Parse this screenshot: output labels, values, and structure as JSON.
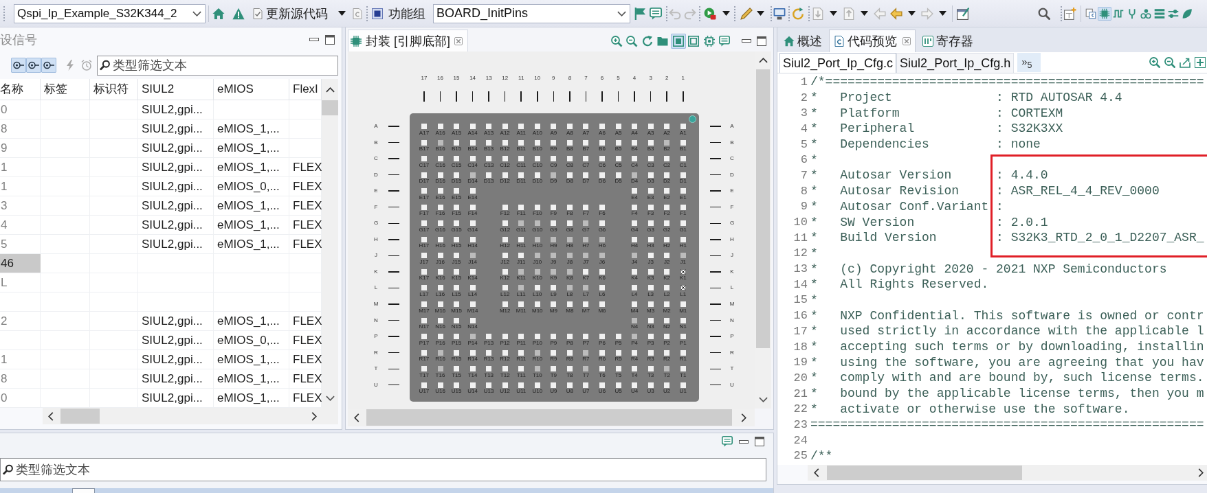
{
  "toolbar": {
    "project": "Qspi_Ip_Example_S32K344_2",
    "update_button": "更新源代码",
    "function_group_label": "功能组",
    "function_group": "BOARD_InitPins",
    "perspectives": [
      {
        "selected": false
      },
      {
        "selected": true
      },
      {
        "selected": false
      },
      {
        "selected": false
      },
      {
        "selected": false
      },
      {
        "selected": false
      },
      {
        "selected": false
      },
      {
        "selected": false
      }
    ]
  },
  "signals_panel": {
    "title": "设信号",
    "filter_toggles": [
      {
        "selected": true
      },
      {
        "selected": true
      },
      {
        "selected": true
      }
    ],
    "search": {
      "placeholder": "类型筛选文本"
    },
    "columns": [
      "名称",
      "标签",
      "标识符",
      "SIUL2",
      "eMIOS",
      "FlexI"
    ],
    "rows": [
      {
        "name": "0",
        "siul2": "SIUL2,gpi...",
        "selected": false
      },
      {
        "name": "8",
        "siul2": "SIUL2,gpi...",
        "emios": "eMIOS_1,...",
        "selected": false
      },
      {
        "name": "9",
        "siul2": "SIUL2,gpi...",
        "emios": "eMIOS_1,...",
        "selected": false
      },
      {
        "name": "1",
        "siul2": "SIUL2,gpi...",
        "emios": "eMIOS_1,...",
        "flexi": "FLEX",
        "selected": false
      },
      {
        "name": "1",
        "siul2": "SIUL2,gpi...",
        "emios": "eMIOS_0,...",
        "flexi": "FLEX",
        "selected": false
      },
      {
        "name": "3",
        "siul2": "SIUL2,gpi...",
        "emios": "eMIOS_1,...",
        "flexi": "FLEX",
        "selected": false
      },
      {
        "name": "4",
        "siul2": "SIUL2,gpi...",
        "emios": "eMIOS_1,...",
        "flexi": "FLEX",
        "selected": false
      },
      {
        "name": "5",
        "siul2": "SIUL2,gpi...",
        "emios": "eMIOS_1,...",
        "flexi": "FLEX",
        "selected": false
      },
      {
        "name": "46",
        "selected": true
      },
      {
        "name": "L",
        "selected": false
      },
      {
        "selected": false
      },
      {
        "name": "2",
        "siul2": "SIUL2,gpi...",
        "emios": "eMIOS_1,...",
        "flexi": "FLEX",
        "selected": false
      },
      {
        "siul2": "SIUL2,gpi...",
        "emios": "eMIOS_0,...",
        "flexi": "FLEX",
        "selected": false
      },
      {
        "name": "1",
        "siul2": "SIUL2,gpi...",
        "emios": "eMIOS_1,...",
        "flexi": "FLEX",
        "selected": false
      },
      {
        "name": "8",
        "siul2": "SIUL2,gpi...",
        "emios": "eMIOS_1,...",
        "flexi": "FLEX",
        "selected": false
      },
      {
        "name": "0",
        "siul2": "SIUL2,gpi...",
        "emios": "eMIOS_1,...",
        "flexi": "FLEX",
        "selected": false
      }
    ]
  },
  "package_panel": {
    "tab": "封装 [引脚底部]",
    "tools": [
      {
        "selected": false
      },
      {
        "selected": false
      },
      {
        "selected": false
      },
      {
        "selected": false
      },
      {
        "selected": true
      },
      {
        "selected": false
      },
      {
        "selected": false
      },
      {
        "selected": false
      }
    ],
    "column_numbers": [
      "17",
      "16",
      "15",
      "14",
      "13",
      "12",
      "11",
      "10",
      "9",
      "8",
      "7",
      "6",
      "5",
      "4",
      "3",
      "2",
      "1"
    ],
    "rows": [
      {
        "letter_left": "A",
        "letter_right": "A",
        "pins_left": [
          {
            "label": "A17",
            "kind": "plain"
          },
          {
            "label": "A16",
            "kind": "plain"
          },
          {
            "label": "A15",
            "kind": "plain"
          },
          {
            "label": "A14",
            "kind": "plain"
          }
        ],
        "pins_center": [
          {
            "label": "A13",
            "kind": "plain"
          },
          {
            "label": "A12",
            "kind": "plain"
          },
          {
            "label": "A11",
            "kind": "plain"
          },
          {
            "label": "A10",
            "kind": "plain"
          },
          {
            "label": "A9",
            "kind": "plain"
          },
          {
            "label": "A8",
            "kind": "plain"
          },
          {
            "label": "A7",
            "kind": "plain"
          },
          {
            "label": "A6",
            "kind": "plain"
          },
          {
            "label": "A5",
            "kind": "plain"
          }
        ],
        "pins_right": [
          {
            "label": "A4",
            "kind": "plain"
          },
          {
            "label": "A3",
            "kind": "plain"
          },
          {
            "label": "A2",
            "kind": "plain"
          },
          {
            "label": "A1",
            "kind": "plain"
          }
        ]
      },
      {
        "letter_left": "B",
        "letter_right": "B",
        "pins_left": [
          {
            "label": "B17",
            "kind": "plain"
          },
          {
            "label": "B16",
            "kind": "shaded"
          },
          {
            "label": "B15",
            "kind": "plain"
          },
          {
            "label": "B14",
            "kind": "plain"
          }
        ],
        "pins_center": [
          {
            "label": "B13",
            "kind": "plain"
          },
          {
            "label": "B12",
            "kind": "plain"
          },
          {
            "label": "B11",
            "kind": "plain"
          },
          {
            "label": "B10",
            "kind": "plain"
          },
          {
            "label": "B9",
            "kind": "plain"
          },
          {
            "label": "B8",
            "kind": "plain"
          },
          {
            "label": "B7",
            "kind": "plain"
          },
          {
            "label": "B6",
            "kind": "plain"
          },
          {
            "label": "B5",
            "kind": "plain"
          }
        ],
        "pins_right": [
          {
            "label": "B4",
            "kind": "plain"
          },
          {
            "label": "B3",
            "kind": "plain"
          },
          {
            "label": "B2",
            "kind": "shaded"
          },
          {
            "label": "B1",
            "kind": "plain"
          }
        ]
      },
      {
        "letter_left": "C",
        "letter_right": "C",
        "pins_left": [
          {
            "label": "C17",
            "kind": "plain"
          },
          {
            "label": "C16",
            "kind": "plain"
          },
          {
            "label": "C15",
            "kind": "plain"
          },
          {
            "label": "C14",
            "kind": "plain"
          }
        ],
        "pins_center": [
          {
            "label": "C13",
            "kind": "plain"
          },
          {
            "label": "C12",
            "kind": "plain"
          },
          {
            "label": "C11",
            "kind": "plain"
          },
          {
            "label": "C10",
            "kind": "plain"
          },
          {
            "label": "C9",
            "kind": "plain"
          },
          {
            "label": "C8",
            "kind": "plain"
          },
          {
            "label": "C7",
            "kind": "plain"
          },
          {
            "label": "C6",
            "kind": "plain"
          },
          {
            "label": "C5",
            "kind": "plain"
          }
        ],
        "pins_right": [
          {
            "label": "C4",
            "kind": "plain"
          },
          {
            "label": "C3",
            "kind": "plain"
          },
          {
            "label": "C2",
            "kind": "plain"
          },
          {
            "label": "C1",
            "kind": "plain"
          }
        ]
      },
      {
        "letter_left": "D",
        "letter_right": "D",
        "pins_left": [
          {
            "label": "D17",
            "kind": "plain"
          },
          {
            "label": "D16",
            "kind": "plain"
          },
          {
            "label": "D15",
            "kind": "plain"
          },
          {
            "label": "D14",
            "kind": "shaded"
          }
        ],
        "pins_center": [
          {
            "label": "D13",
            "kind": "plain"
          },
          {
            "label": "D12",
            "kind": "plain"
          },
          {
            "label": "D11",
            "kind": "plain"
          },
          {
            "label": "D10",
            "kind": "plain"
          },
          {
            "label": "D9",
            "kind": "shaded"
          },
          {
            "label": "D8",
            "kind": "plain"
          },
          {
            "label": "D7",
            "kind": "plain"
          },
          {
            "label": "D6",
            "kind": "plain"
          },
          {
            "label": "D5",
            "kind": "plain"
          }
        ],
        "pins_right": [
          {
            "label": "D4",
            "kind": "shaded"
          },
          {
            "label": "D3",
            "kind": "plain"
          },
          {
            "label": "D2",
            "kind": "plain"
          },
          {
            "label": "D1",
            "kind": "plain"
          }
        ]
      },
      {
        "letter_left": "E",
        "letter_right": "E",
        "pins_left": [
          {
            "label": "E17",
            "kind": "plain"
          },
          {
            "label": "E16",
            "kind": "plain"
          },
          {
            "label": "E15",
            "kind": "plain"
          },
          {
            "label": "E14",
            "kind": "plain"
          }
        ],
        "pins_right": [
          {
            "label": "E4",
            "kind": "plain"
          },
          {
            "label": "E3",
            "kind": "plain"
          },
          {
            "label": "E2",
            "kind": "plain"
          },
          {
            "label": "E1",
            "kind": "plain"
          }
        ]
      },
      {
        "letter_left": "F",
        "letter_right": "F",
        "pins_left": [
          {
            "label": "F17",
            "kind": "plain"
          },
          {
            "label": "F16",
            "kind": "plain"
          },
          {
            "label": "F15",
            "kind": "plain"
          },
          {
            "label": "F14",
            "kind": "plain"
          }
        ],
        "pins_center": [
          {
            "label": "F12",
            "kind": "plain"
          },
          {
            "label": "F11",
            "kind": "plain"
          },
          {
            "label": "F10",
            "kind": "plain"
          },
          {
            "label": "F9",
            "kind": "plain"
          },
          {
            "label": "F8",
            "kind": "plain"
          },
          {
            "label": "F7",
            "kind": "plain"
          },
          {
            "label": "F6",
            "kind": "plain"
          }
        ],
        "pins_right": [
          {
            "label": "F4",
            "kind": "plain"
          },
          {
            "label": "F3",
            "kind": "plain"
          },
          {
            "label": "F2",
            "kind": "plain"
          },
          {
            "label": "F1",
            "kind": "plain"
          }
        ]
      },
      {
        "letter_left": "G",
        "letter_right": "G",
        "pins_left": [
          {
            "label": "G17",
            "kind": "plain"
          },
          {
            "label": "G16",
            "kind": "plain"
          },
          {
            "label": "G15",
            "kind": "plain"
          },
          {
            "label": "G14",
            "kind": "plain"
          }
        ],
        "pins_center": [
          {
            "label": "G12",
            "kind": "plain"
          },
          {
            "label": "G11",
            "kind": "shaded"
          },
          {
            "label": "G10",
            "kind": "shaded"
          },
          {
            "label": "G9",
            "kind": "plain"
          },
          {
            "label": "G8",
            "kind": "plain"
          },
          {
            "label": "G7",
            "kind": "shaded"
          },
          {
            "label": "G6",
            "kind": "plain"
          }
        ],
        "pins_right": [
          {
            "label": "G4",
            "kind": "plain"
          },
          {
            "label": "G3",
            "kind": "plain"
          },
          {
            "label": "G2",
            "kind": "plain"
          },
          {
            "label": "G1",
            "kind": "plain"
          }
        ]
      },
      {
        "letter_left": "H",
        "letter_right": "H",
        "pins_left": [
          {
            "label": "H17",
            "kind": "plain"
          },
          {
            "label": "H16",
            "kind": "plain"
          },
          {
            "label": "H15",
            "kind": "plain"
          },
          {
            "label": "H14",
            "kind": "plain"
          }
        ],
        "pins_center": [
          {
            "label": "H12",
            "kind": "plain"
          },
          {
            "label": "H11",
            "kind": "plain"
          },
          {
            "label": "H10",
            "kind": "shaded"
          },
          {
            "label": "H9",
            "kind": "shaded"
          },
          {
            "label": "H8",
            "kind": "shaded"
          },
          {
            "label": "H7",
            "kind": "shaded"
          },
          {
            "label": "H6",
            "kind": "shaded"
          }
        ],
        "pins_right": [
          {
            "label": "H4",
            "kind": "plain"
          },
          {
            "label": "H3",
            "kind": "plain"
          },
          {
            "label": "H2",
            "kind": "plain"
          },
          {
            "label": "H1",
            "kind": "plain"
          }
        ]
      },
      {
        "letter_left": "J",
        "letter_right": "J",
        "pins_left": [
          {
            "label": "J17",
            "kind": "plain"
          },
          {
            "label": "J16",
            "kind": "plain"
          },
          {
            "label": "J15",
            "kind": "plain"
          },
          {
            "label": "J14",
            "kind": "shaded"
          }
        ],
        "pins_center": [
          {
            "label": "J12",
            "kind": "plain"
          },
          {
            "label": "J11",
            "kind": "plain"
          },
          {
            "label": "J10",
            "kind": "shaded"
          },
          {
            "label": "J9",
            "kind": "shaded"
          },
          {
            "label": "J8",
            "kind": "shaded"
          },
          {
            "label": "J7",
            "kind": "shaded"
          },
          {
            "label": "J6",
            "kind": "shaded"
          }
        ],
        "pins_right": [
          {
            "label": "J4",
            "kind": "shaded"
          },
          {
            "label": "J3",
            "kind": "plain"
          },
          {
            "label": "J2",
            "kind": "plain"
          },
          {
            "label": "J1",
            "kind": "shaded"
          }
        ]
      },
      {
        "letter_left": "K",
        "letter_right": "K",
        "pins_left": [
          {
            "label": "K17",
            "kind": "plain"
          },
          {
            "label": "K16",
            "kind": "plain"
          },
          {
            "label": "K15",
            "kind": "plain"
          },
          {
            "label": "K14",
            "kind": "plain"
          }
        ],
        "pins_center": [
          {
            "label": "K12",
            "kind": "plain"
          },
          {
            "label": "K11",
            "kind": "shaded"
          },
          {
            "label": "K10",
            "kind": "shaded"
          },
          {
            "label": "K9",
            "kind": "shaded"
          },
          {
            "label": "K8",
            "kind": "shaded"
          },
          {
            "label": "K7",
            "kind": "plain"
          },
          {
            "label": "K6",
            "kind": "plain"
          }
        ],
        "pins_right": [
          {
            "label": "K4",
            "kind": "plain"
          },
          {
            "label": "K3",
            "kind": "plain"
          },
          {
            "label": "K2",
            "kind": "plain"
          },
          {
            "label": "K1",
            "kind": "crossed"
          }
        ]
      },
      {
        "letter_left": "L",
        "letter_right": "L",
        "pins_left": [
          {
            "label": "L17",
            "kind": "plain"
          },
          {
            "label": "L16",
            "kind": "plain"
          },
          {
            "label": "L15",
            "kind": "plain"
          },
          {
            "label": "L14",
            "kind": "plain"
          }
        ],
        "pins_center": [
          {
            "label": "L12",
            "kind": "plain"
          },
          {
            "label": "L11",
            "kind": "shaded"
          },
          {
            "label": "L10",
            "kind": "plain"
          },
          {
            "label": "L9",
            "kind": "plain"
          },
          {
            "label": "L8",
            "kind": "shaded"
          },
          {
            "label": "L7",
            "kind": "shaded"
          },
          {
            "label": "L6",
            "kind": "plain"
          }
        ],
        "pins_right": [
          {
            "label": "L4",
            "kind": "plain"
          },
          {
            "label": "L3",
            "kind": "plain"
          },
          {
            "label": "L2",
            "kind": "plain"
          },
          {
            "label": "L1",
            "kind": "crossed"
          }
        ]
      },
      {
        "letter_left": "M",
        "letter_right": "M",
        "pins_left": [
          {
            "label": "M17",
            "kind": "plain"
          },
          {
            "label": "M16",
            "kind": "plain"
          },
          {
            "label": "M15",
            "kind": "plain"
          },
          {
            "label": "M14",
            "kind": "plain"
          }
        ],
        "pins_center": [
          {
            "label": "M12",
            "kind": "plain"
          },
          {
            "label": "M11",
            "kind": "plain"
          },
          {
            "label": "M10",
            "kind": "plain"
          },
          {
            "label": "M9",
            "kind": "plain"
          },
          {
            "label": "M8",
            "kind": "plain"
          },
          {
            "label": "M7",
            "kind": "plain"
          },
          {
            "label": "M6",
            "kind": "plain"
          }
        ],
        "pins_right": [
          {
            "label": "M4",
            "kind": "plain"
          },
          {
            "label": "M3",
            "kind": "plain"
          },
          {
            "label": "M2",
            "kind": "plain"
          },
          {
            "label": "M1",
            "kind": "plain"
          }
        ]
      },
      {
        "letter_left": "N",
        "letter_right": "N",
        "pins_left": [
          {
            "label": "N17",
            "kind": "plain"
          },
          {
            "label": "N16",
            "kind": "plain"
          },
          {
            "label": "N15",
            "kind": "plain"
          },
          {
            "label": "N14",
            "kind": "plain"
          }
        ],
        "pins_right": [
          {
            "label": "N4",
            "kind": "shaded"
          },
          {
            "label": "N3",
            "kind": "plain"
          },
          {
            "label": "N2",
            "kind": "plain"
          },
          {
            "label": "N1",
            "kind": "plain"
          }
        ]
      },
      {
        "letter_left": "P",
        "letter_right": "P",
        "pins_left": [
          {
            "label": "P17",
            "kind": "plain"
          },
          {
            "label": "P16",
            "kind": "plain"
          },
          {
            "label": "P15",
            "kind": "plain"
          },
          {
            "label": "P14",
            "kind": "shaded"
          }
        ],
        "pins_center": [
          {
            "label": "P13",
            "kind": "plain"
          },
          {
            "label": "P12",
            "kind": "plain"
          },
          {
            "label": "P11",
            "kind": "plain"
          },
          {
            "label": "P10",
            "kind": "plain"
          },
          {
            "label": "P9",
            "kind": "plain"
          },
          {
            "label": "P8",
            "kind": "plain"
          },
          {
            "label": "P7",
            "kind": "plain"
          },
          {
            "label": "P6",
            "kind": "plain"
          },
          {
            "label": "P5",
            "kind": "plain"
          }
        ],
        "pins_right": [
          {
            "label": "P4",
            "kind": "shaded"
          },
          {
            "label": "P3",
            "kind": "plain"
          },
          {
            "label": "P2",
            "kind": "plain"
          },
          {
            "label": "P1",
            "kind": "plain"
          }
        ]
      },
      {
        "letter_left": "R",
        "letter_right": "R",
        "pins_left": [
          {
            "label": "R17",
            "kind": "plain"
          },
          {
            "label": "R16",
            "kind": "shaded"
          },
          {
            "label": "R15",
            "kind": "plain"
          },
          {
            "label": "R14",
            "kind": "plain"
          }
        ],
        "pins_center": [
          {
            "label": "R13",
            "kind": "plain"
          },
          {
            "label": "R12",
            "kind": "plain"
          },
          {
            "label": "R11",
            "kind": "plain"
          },
          {
            "label": "R10",
            "kind": "shaded"
          },
          {
            "label": "R9",
            "kind": "plain"
          },
          {
            "label": "R8",
            "kind": "plain"
          },
          {
            "label": "R7",
            "kind": "shaded"
          },
          {
            "label": "R6",
            "kind": "plain"
          },
          {
            "label": "R5",
            "kind": "plain"
          }
        ],
        "pins_right": [
          {
            "label": "R4",
            "kind": "plain"
          },
          {
            "label": "R3",
            "kind": "plain"
          },
          {
            "label": "R2",
            "kind": "plain"
          },
          {
            "label": "R1",
            "kind": "plain"
          }
        ]
      },
      {
        "letter_left": "T",
        "letter_right": "T",
        "pins_left": [
          {
            "label": "T17",
            "kind": "plain"
          },
          {
            "label": "T16",
            "kind": "shaded"
          },
          {
            "label": "T15",
            "kind": "plain"
          },
          {
            "label": "T14",
            "kind": "plain"
          }
        ],
        "pins_center": [
          {
            "label": "T13",
            "kind": "plain"
          },
          {
            "label": "T12",
            "kind": "plain"
          },
          {
            "label": "T11",
            "kind": "plain"
          },
          {
            "label": "T10",
            "kind": "shaded"
          },
          {
            "label": "T9",
            "kind": "plain"
          },
          {
            "label": "T8",
            "kind": "plain"
          },
          {
            "label": "T7",
            "kind": "shaded"
          },
          {
            "label": "T6",
            "kind": "plain"
          },
          {
            "label": "T5",
            "kind": "plain"
          }
        ],
        "pins_right": [
          {
            "label": "T4",
            "kind": "plain"
          },
          {
            "label": "T3",
            "kind": "plain"
          },
          {
            "label": "T2",
            "kind": "shaded"
          },
          {
            "label": "T1",
            "kind": "plain"
          }
        ]
      },
      {
        "letter_left": "U",
        "letter_right": "U",
        "pins_left": [
          {
            "label": "U17",
            "kind": "plain"
          },
          {
            "label": "U16",
            "kind": "plain"
          },
          {
            "label": "U15",
            "kind": "plain"
          },
          {
            "label": "U14",
            "kind": "plain"
          }
        ],
        "pins_center": [
          {
            "label": "U13",
            "kind": "plain"
          },
          {
            "label": "U12",
            "kind": "plain"
          },
          {
            "label": "U11",
            "kind": "plain"
          },
          {
            "label": "U10",
            "kind": "plain"
          },
          {
            "label": "U9",
            "kind": "plain"
          },
          {
            "label": "U8",
            "kind": "plain"
          },
          {
            "label": "U7",
            "kind": "plain"
          },
          {
            "label": "U6",
            "kind": "plain"
          },
          {
            "label": "U5",
            "kind": "plain"
          }
        ],
        "pins_right": [
          {
            "label": "U4",
            "kind": "plain"
          },
          {
            "label": "U3",
            "kind": "plain"
          },
          {
            "label": "U2",
            "kind": "plain"
          },
          {
            "label": "U1",
            "kind": "plain"
          }
        ]
      }
    ]
  },
  "code_panel": {
    "tabs": [
      {
        "label": "概述",
        "selected": false
      },
      {
        "label": "代码预览",
        "selected": true
      },
      {
        "label": "寄存器",
        "selected": false
      }
    ],
    "file_tabs": [
      {
        "label": "Siul2_Port_Ip_Cfg.c",
        "selected": true
      },
      {
        "label": "Siul2_Port_Ip_Cfg.h",
        "selected": false
      }
    ],
    "more_tabs": "»$_{5}$",
    "lines": [
      {
        "number": "1",
        "text": "/*==================================================="
      },
      {
        "number": "2",
        "text": "*   Project              : RTD AUTOSAR 4.4"
      },
      {
        "number": "3",
        "text": "*   Platform             : CORTEXM"
      },
      {
        "number": "4",
        "text": "*   Peripheral           : S32K3XX"
      },
      {
        "number": "5",
        "text": "*   Dependencies         : none"
      },
      {
        "number": "6",
        "text": "*"
      },
      {
        "number": "7",
        "text": "*   Autosar Version      : 4.4.0"
      },
      {
        "number": "8",
        "text": "*   Autosar Revision     : ASR_REL_4_4_REV_0000"
      },
      {
        "number": "9",
        "text": "*   Autosar Conf.Variant :"
      },
      {
        "number": "10",
        "text": "*   SW Version           : 2.0.1"
      },
      {
        "number": "11",
        "text": "*   Build Version        : S32K3_RTD_2_0_1_D2207_ASR_"
      },
      {
        "number": "12",
        "text": "*"
      },
      {
        "number": "13",
        "text": "*   (c) Copyright 2020 - 2021 NXP Semiconductors"
      },
      {
        "number": "14",
        "text": "*   All Rights Reserved."
      },
      {
        "number": "15",
        "text": "*"
      },
      {
        "number": "16",
        "text": "*   NXP Confidential. This software is owned or contr"
      },
      {
        "number": "17",
        "text": "*   used strictly in accordance with the applicable l"
      },
      {
        "number": "18",
        "text": "*   accepting such terms or by downloading, installin"
      },
      {
        "number": "19",
        "text": "*   using the software, you are agreeing that you hav"
      },
      {
        "number": "20",
        "text": "*   comply with and are bound by, such license terms."
      },
      {
        "number": "21",
        "text": "*   bound by the applicable license terms, then you m"
      },
      {
        "number": "22",
        "text": "*   activate or otherwise use the software."
      },
      {
        "number": "23",
        "text": "====================================================="
      },
      {
        "number": "24"
      },
      {
        "number": "25",
        "text": "/**"
      }
    ]
  },
  "bottom_panel": {
    "search": {
      "placeholder": "类型筛选文本"
    }
  }
}
